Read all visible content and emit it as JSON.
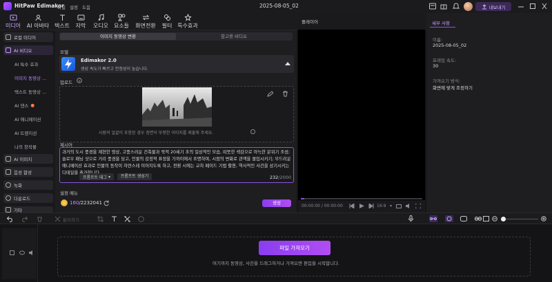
{
  "titlebar": {
    "app_name": "HitPaw Edimakor",
    "menus": [
      "파일",
      "설정",
      "도움"
    ],
    "project_title": "2025-08-05_02",
    "export_label": "내보내기"
  },
  "top_tabs": [
    {
      "label": "미디어",
      "icon": "media-icon",
      "active": true
    },
    {
      "label": "AI 아바타",
      "icon": "ai-avatar-icon",
      "active": false
    },
    {
      "label": "텍스트",
      "icon": "text-icon",
      "active": false
    },
    {
      "label": "자막",
      "icon": "subtitle-icon",
      "active": false
    },
    {
      "label": "오디오",
      "icon": "audio-icon",
      "active": false
    },
    {
      "label": "요소들",
      "icon": "elements-icon",
      "active": false
    },
    {
      "label": "화면전환",
      "icon": "transition-icon",
      "active": false
    },
    {
      "label": "필터",
      "icon": "filter-icon",
      "active": false
    },
    {
      "label": "특수효과",
      "icon": "effects-icon",
      "active": false
    }
  ],
  "sidebar": {
    "local_media": "로컬 미디어",
    "ai_video": "AI 비디오",
    "sub_items": [
      "AI 특수 효과",
      "이미지 동영상 ...",
      "텍스트 동영상 ...",
      "AI 댄스",
      "AI 애니메이션",
      "AI 트랜지션",
      "나의 창작물"
    ],
    "ai_image": "AI 이미지",
    "speech": "음성 합성",
    "record": "녹화",
    "download": "다운로드",
    "more": "기타"
  },
  "center": {
    "tabs": [
      "이미지 동영상 변환",
      "참고용 비디오"
    ],
    "model_label": "모델",
    "model_name": "Edimakor 2.0",
    "model_desc": "생성 속도가 빠르고 안정성이 높습니다.",
    "upload_label": "업로드",
    "upload_hint": "사람의 얼굴이 포함된 경우 정면이 뚜렷한 이미지를 제출해 주세요.",
    "prompt_label": "제시어",
    "prompt_text": "과거의 도시 풍경을 재현한 영상, 고풍스러운 건축물과 북적 20세기 초의 일상적인 모습, 따뜻한 색감으로 아늑한 분위기 조성; 슬로우 패닝 샷으로 거리 풍경을 담고, 인물의 감정적 표정을 가까이에서 조명하며, 시점의 변화로 관객을 몰입시키기; 부드러운 애니메이션 효과로 인물의 동작이 자연스레 이어지도록 하고, 전환 시에는 교차 페이드 기법 활용, 역사적인 사건을 상기시키는 디테일을 추가합니다.",
    "prompt_tag": "프롬프트 태그",
    "prompt_gen": "프롬프트 생성기",
    "char_count": "232",
    "char_max": "/2000",
    "settings_label": "설정 메뉴",
    "credits_used": "160",
    "credits_total": "/2232041",
    "generate_label": "생성"
  },
  "player": {
    "title": "플레이어",
    "time_current": "00:00:00",
    "time_sep": "/",
    "time_total": "00:00:00",
    "ratio": "16:9"
  },
  "props": {
    "tab": "세부 사항",
    "name_label": "이름:",
    "name_value": "2025-08-05_02",
    "fps_label": "프레임 속도:",
    "fps_value": "30",
    "fit_label": "가져오기 방식:",
    "fit_value": "화면에 맞게 조정하기"
  },
  "tl_toolbar": {
    "disabled_label": "분리하기"
  },
  "timeline": {
    "import_label": "파일 가져오기",
    "drop_hint": "여기까지 동영상, 사진을 드래그하거나 가져오면 편집을 시작합니다."
  },
  "colors": {
    "accent": "#9b4ff0",
    "accent_text": "#c9a2ff",
    "panel": "#1e1e21",
    "bg": "#141416"
  }
}
